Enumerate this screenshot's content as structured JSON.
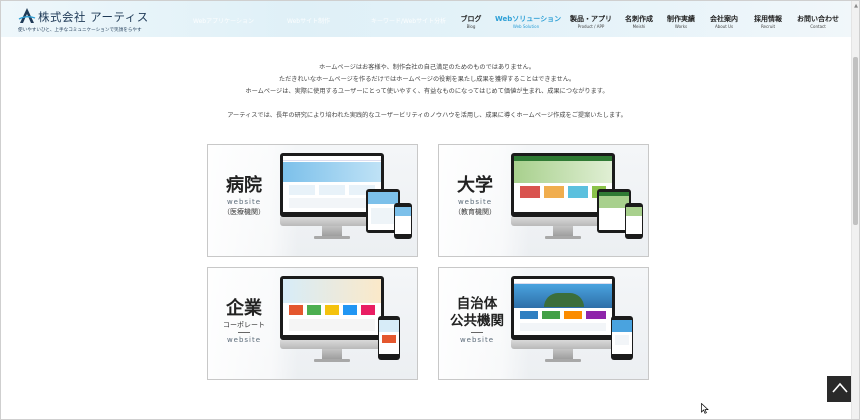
{
  "header": {
    "logo_name": "株式会社 アーティス",
    "logo_tagline": "使いやすいひと、上手なコミュニケーションで笑顔をらやす",
    "ghost_links": [
      "Webアプリケーション",
      "Webサイト制作",
      "キーワード/Webサイト分析"
    ],
    "nav": [
      {
        "label": "ブログ",
        "sub": "Blog"
      },
      {
        "label": "Webソリューション",
        "sub": "Web Solution",
        "active": true
      },
      {
        "label": "製品・アプリ",
        "sub": "Product / APP"
      },
      {
        "label": "名刺作成",
        "sub": "Meishi"
      },
      {
        "label": "制作実績",
        "sub": "Works"
      },
      {
        "label": "会社案内",
        "sub": "About Us"
      },
      {
        "label": "採用情報",
        "sub": "Recruit"
      },
      {
        "label": "お問い合わせ",
        "sub": "Contact"
      }
    ]
  },
  "intro": {
    "line1": "ホームページはお客様や、制作会社の自己満足のためのものではありません。",
    "line2": "ただきれいなホームページを作るだけではホームページの役割を果たし成果を獲得することはできません。",
    "line3": "ホームページは、実際に使用するユーザーにとって使いやすく、有益なものになってはじめて価値が生まれ、成果につながります。",
    "line4": "アーティスでは、長年の研究により培われた実践的なユーザービリティのノウハウを活用し、成果に導くホームページ作成をご提案いたします。"
  },
  "cards": [
    {
      "title": "病院",
      "website": "website",
      "sub": "（医療機関）",
      "accent": "#2a8fd0"
    },
    {
      "title": "大学",
      "website": "website",
      "sub": "（教育機関）",
      "accent": "#3a9a3a"
    },
    {
      "title": "企業",
      "title_sub": "コーポレート",
      "website": "website",
      "accent": "#e4572e"
    },
    {
      "title": "自治体",
      "title2": "公共機関",
      "website": "website",
      "accent": "#2f7fc1"
    }
  ],
  "colors": {
    "active_nav": "#2c9fd6",
    "totop_bg": "#2a2a2a"
  },
  "icons": {
    "logo": "artis-a-logo",
    "totop": "chevron-up-icon",
    "cursor": "mouse-pointer-icon"
  }
}
